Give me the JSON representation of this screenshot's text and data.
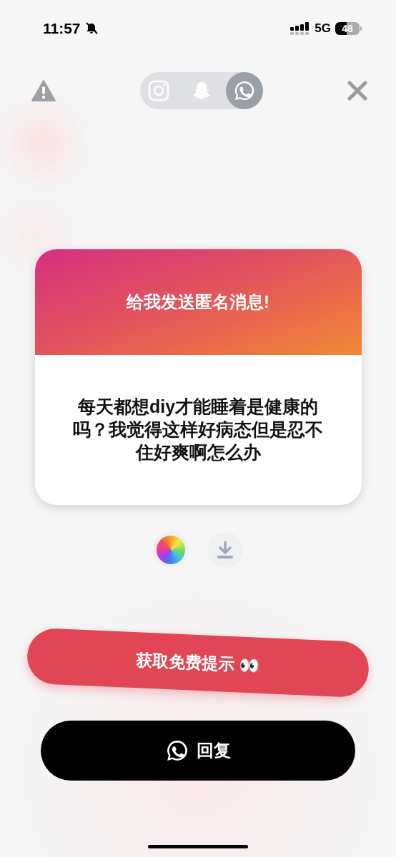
{
  "status_bar": {
    "time": "11:57",
    "network": "5G",
    "battery": "48"
  },
  "share_targets": [
    {
      "kind": "instagram",
      "selected": false
    },
    {
      "kind": "snapchat",
      "selected": false
    },
    {
      "kind": "whatsapp",
      "selected": true
    }
  ],
  "card": {
    "title": "给我发送匿名消息!",
    "message": "每天都想diy才能睡着是健康的吗？我觉得这样好病态但是忍不住好爽啊怎么办"
  },
  "hint_button": {
    "label": "获取免费提示 👀"
  },
  "reply_button": {
    "label": "回复"
  }
}
